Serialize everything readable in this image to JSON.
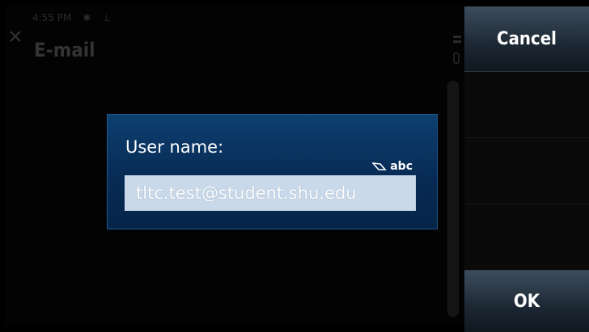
{
  "status": {
    "time": "4:55 PM",
    "bluetooth_icon": "bluetooth-icon",
    "usb_icon": "usb-icon"
  },
  "app": {
    "title": "E-mail",
    "close_icon": "close-icon"
  },
  "dialog": {
    "label": "User name:",
    "input_mode": "abc",
    "input_value": "tltc.test@student.shu.edu"
  },
  "softkeys": {
    "cancel": "Cancel",
    "ok": "OK"
  },
  "colors": {
    "dialog_bg": "#0b3a6a",
    "input_bg": "#c9d9ea",
    "softkey_bg": "#1c2733"
  }
}
